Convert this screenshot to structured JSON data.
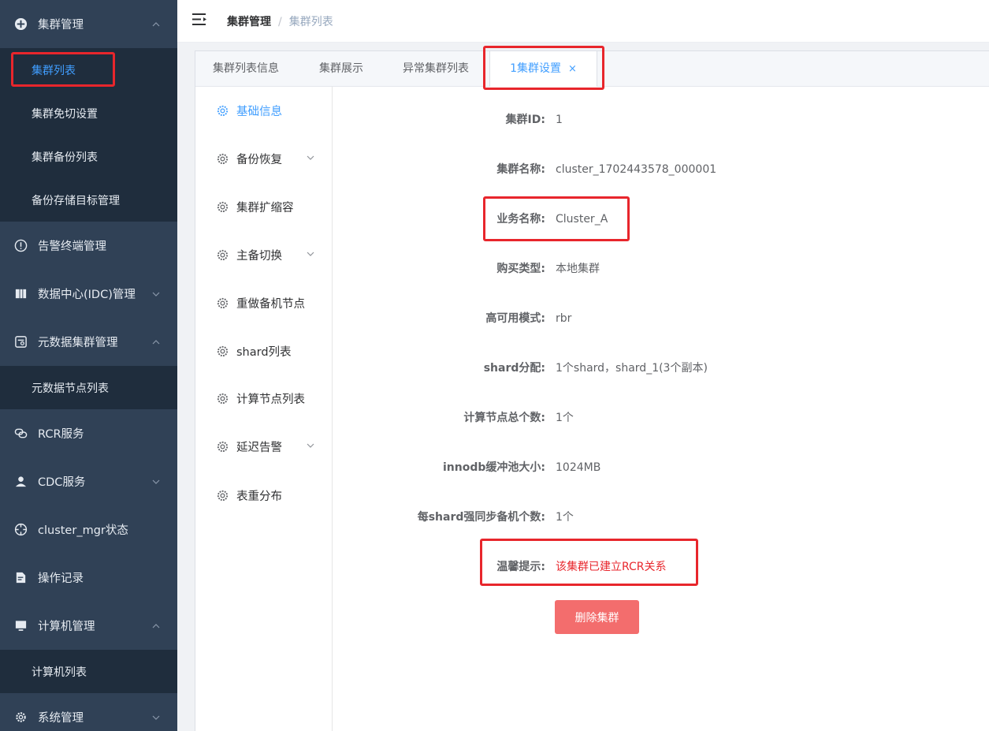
{
  "sidebar": {
    "groups": [
      {
        "label": "集群管理",
        "icon": "cluster-icon",
        "expanded": true,
        "children": [
          "集群列表",
          "集群免切设置",
          "集群备份列表",
          "备份存储目标管理"
        ]
      },
      {
        "label": "告警终端管理",
        "icon": "alert-circle-icon"
      },
      {
        "label": "数据中心(IDC)管理",
        "icon": "datacenter-icon",
        "expanded": false
      },
      {
        "label": "元数据集群管理",
        "icon": "metadata-icon",
        "expanded": true,
        "children": [
          "元数据节点列表"
        ]
      },
      {
        "label": "RCR服务",
        "icon": "link-icon"
      },
      {
        "label": "CDC服务",
        "icon": "user-icon",
        "expanded": false
      },
      {
        "label": "cluster_mgr状态",
        "icon": "crosshair-icon"
      },
      {
        "label": "操作记录",
        "icon": "document-icon"
      },
      {
        "label": "计算机管理",
        "icon": "monitor-icon",
        "expanded": true,
        "children": [
          "计算机列表"
        ]
      },
      {
        "label": "系统管理",
        "icon": "gear-icon",
        "expanded": false
      }
    ],
    "active_item": "集群列表"
  },
  "header": {
    "breadcrumb_root": "集群管理",
    "breadcrumb_sep": "/",
    "breadcrumb_current": "集群列表"
  },
  "tabs": [
    "集群列表信息",
    "集群展示",
    "异常集群列表",
    "1集群设置"
  ],
  "tab_close": "×",
  "settings_menu": [
    "基础信息",
    "备份恢复",
    "集群扩缩容",
    "主备切换",
    "重做备机节点",
    "shard列表",
    "计算节点列表",
    "延迟告警",
    "表重分布"
  ],
  "info": [
    {
      "label": "集群ID:",
      "value": "1"
    },
    {
      "label": "集群名称:",
      "value": "cluster_1702443578_000001"
    },
    {
      "label": "业务名称:",
      "value": "Cluster_A"
    },
    {
      "label": "购买类型:",
      "value": "本地集群"
    },
    {
      "label": "高可用模式:",
      "value": "rbr"
    },
    {
      "label": "shard分配:",
      "value": "1个shard，shard_1(3个副本)"
    },
    {
      "label": "计算节点总个数:",
      "value": "1个"
    },
    {
      "label": "innodb缓冲池大小:",
      "value": "1024MB"
    },
    {
      "label": "每shard强同步备机个数:",
      "value": "1个"
    },
    {
      "label": "温馨提示:",
      "value": "该集群已建立RCR关系"
    }
  ],
  "delete_button": "删除集群",
  "colors": {
    "sidebar_bg": "#304156",
    "submenu_bg": "#1f2d3d",
    "accent": "#409eff",
    "highlight": "#e8262c",
    "delete_btn": "#f36d6d"
  }
}
